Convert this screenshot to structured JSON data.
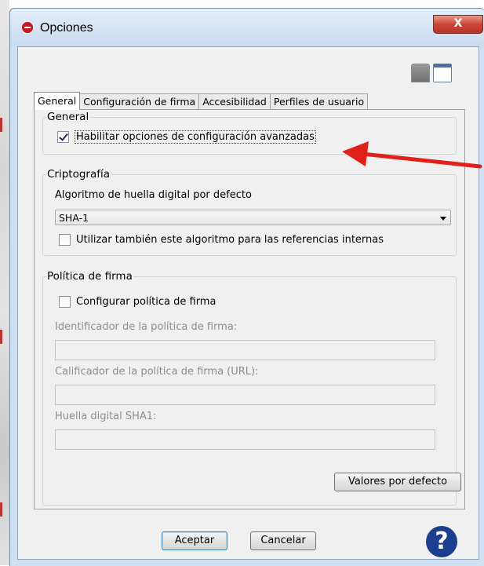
{
  "window": {
    "title": "Opciones",
    "close_glyph": "X"
  },
  "tabs": [
    {
      "label": "General",
      "active": true
    },
    {
      "label": "Configuración de firma",
      "active": false
    },
    {
      "label": "Accesibilidad",
      "active": false
    },
    {
      "label": "Perfiles de usuario",
      "active": false
    }
  ],
  "general_group": {
    "title": "General",
    "advanced_options": {
      "label": "Habilitar opciones de configuración avanzadas",
      "checked": true
    }
  },
  "crypto_group": {
    "title": "Criptografía",
    "algorithm_label": "Algoritmo de huella digital por defecto",
    "algorithm_value": "SHA-1",
    "internal_refs": {
      "label": "Utilizar también este algoritmo para las referencias internas",
      "checked": false
    }
  },
  "policy_group": {
    "title": "Política de firma",
    "configure_policy": {
      "label": "Configurar política de firma",
      "checked": false
    },
    "identifier_label": "Identificador de la política de firma:",
    "identifier_value": "",
    "qualifier_label": "Calificador de la política de firma (URL):",
    "qualifier_value": "",
    "hash_label": "Huella digital SHA1:",
    "hash_value": ""
  },
  "buttons": {
    "defaults": "Valores por defecto",
    "accept": "Aceptar",
    "cancel": "Cancelar",
    "help_glyph": "?"
  },
  "colors": {
    "annotation_arrow": "#e0201b",
    "help_icon": "#1b3e8f",
    "app_icon": "#c8161d"
  }
}
